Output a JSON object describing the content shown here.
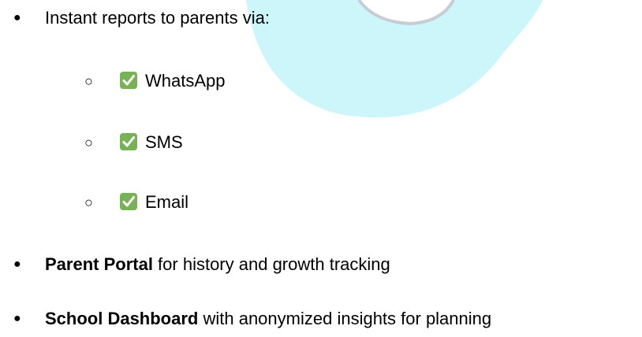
{
  "list": {
    "item_1": "Instant reports to parents via:",
    "sub_items": [
      "WhatsApp",
      "SMS",
      "Email"
    ],
    "item_2_bold": "Parent Portal",
    "item_2_rest": " for history and growth tracking",
    "item_3_bold": "School Dashboard",
    "item_3_rest": " with anonymized insights for planning"
  },
  "glyphs": {
    "bullet": "●",
    "sub_bullet": "○"
  },
  "icons": {
    "sub_item_icon": "check-mark-button-icon"
  },
  "colors": {
    "text": "#000000",
    "watermark": "#cdf6fa",
    "check_green": "#77b255"
  }
}
